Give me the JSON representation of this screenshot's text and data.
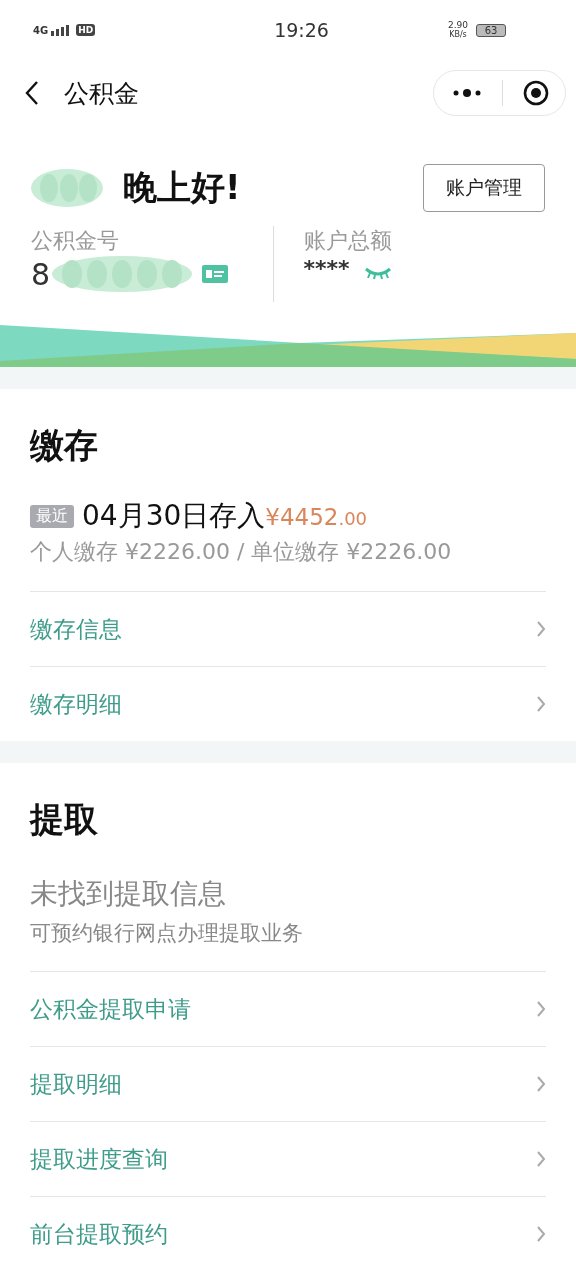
{
  "status_bar": {
    "network": "4G",
    "hd": "HD",
    "time": "19:26",
    "speed": "2.90",
    "speed_unit": "KB/s",
    "battery": "63"
  },
  "nav": {
    "title": "公积金"
  },
  "header": {
    "greeting": "晚上好!",
    "manage_button": "账户管理",
    "account_label": "公积金号",
    "account_number": "8",
    "balance_label": "账户总额",
    "balance": "****"
  },
  "sections": [
    {
      "title": "缴存",
      "latest": {
        "badge": "最近",
        "text": "04月30日存入",
        "amount": "¥4452",
        "cents": ".00",
        "detail": "个人缴存 ¥2226.00 / 单位缴存 ¥2226.00"
      },
      "links": [
        "缴存信息",
        "缴存明细"
      ]
    },
    {
      "title": "提取",
      "notice": {
        "headline": "未找到提取信息",
        "hint": "可预约银行网点办理提取业务"
      },
      "links": [
        "公积金提取申请",
        "提取明细",
        "提取进度查询",
        "前台提取预约"
      ]
    }
  ]
}
